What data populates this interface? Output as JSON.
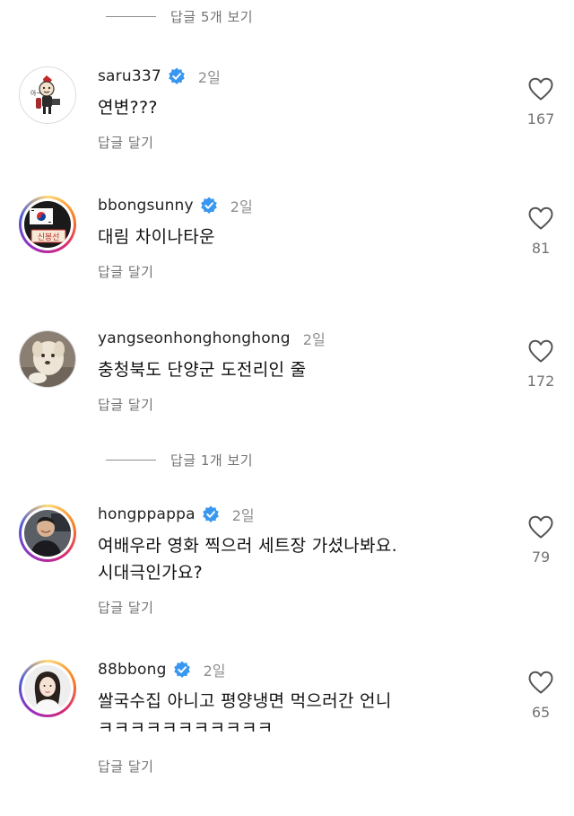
{
  "view_replies_1": "답글 5개 보기",
  "view_replies_2": "답글 1개 보기",
  "reply_label": "답글 달기",
  "comments": [
    {
      "username": "saru337",
      "verified": true,
      "time": "2일",
      "text": "연변???",
      "likes": "167",
      "avatar_icon": "cartoon-character-avatar"
    },
    {
      "username": "bbongsunny",
      "verified": true,
      "time": "2일",
      "text": "대림 차이나타운",
      "likes": "81",
      "avatar_icon": "korean-flag-name-tag-avatar",
      "avatar_text": "신봉선"
    },
    {
      "username": "yangseonhonghonghong",
      "verified": false,
      "time": "2일",
      "text": "충청북도 단양군 도전리인 줄",
      "likes": "172",
      "avatar_icon": "puppy-photo-avatar"
    },
    {
      "username": "hongppappa",
      "verified": true,
      "time": "2일",
      "text_lines": [
        "여배우라 영화 찍으러 세트장 가셨나봐요.",
        "시대극인가요?"
      ],
      "likes": "79",
      "avatar_icon": "man-photo-avatar"
    },
    {
      "username": "88bbong",
      "verified": true,
      "time": "2일",
      "text_lines": [
        "쌀국수집 아니고 평양냉면 먹으러간 언니",
        "ㅋㅋㅋㅋㅋㅋㅋㅋㅋㅋㅋ"
      ],
      "likes": "65",
      "avatar_icon": "woman-photo-avatar"
    }
  ],
  "colors": {
    "verified_badge": "#3897f0",
    "muted_text": "#737373",
    "primary_text": "#111111"
  }
}
